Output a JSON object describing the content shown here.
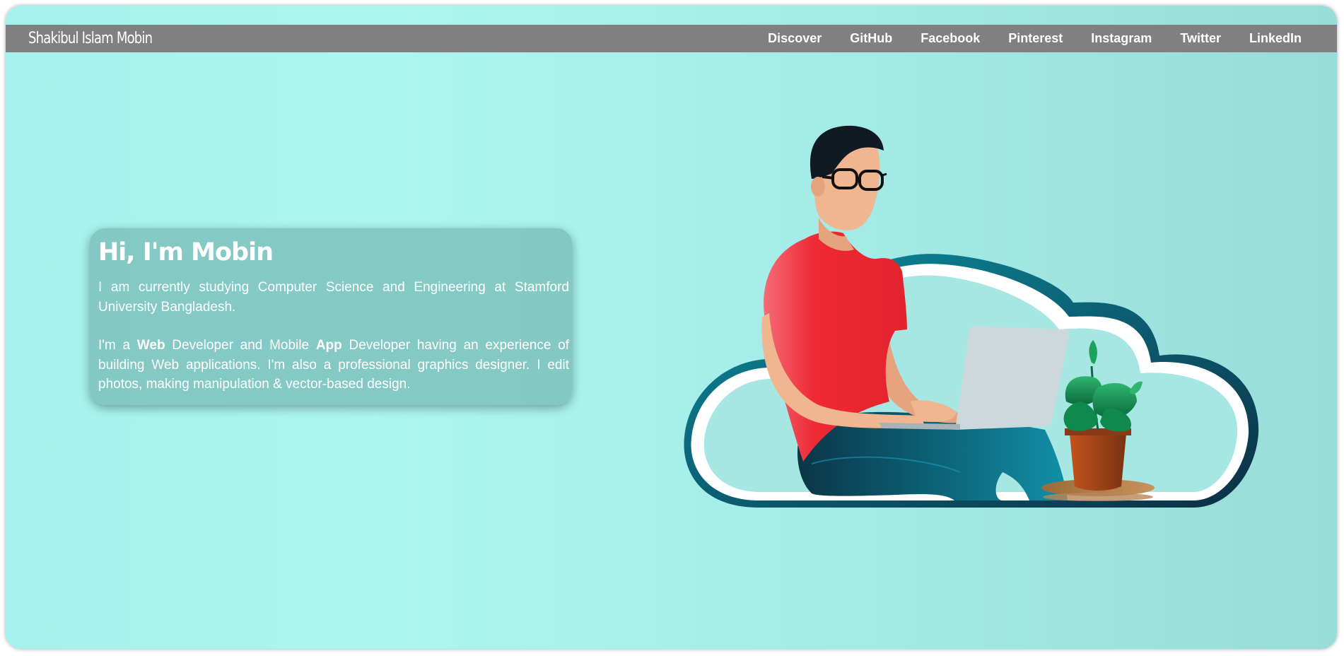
{
  "brand": "Shakibul Islam Mobin",
  "nav": {
    "items": [
      {
        "label": "Discover"
      },
      {
        "label": "GitHub"
      },
      {
        "label": "Facebook"
      },
      {
        "label": "Pinterest"
      },
      {
        "label": "Instagram"
      },
      {
        "label": "Twitter"
      },
      {
        "label": "LinkedIn"
      }
    ]
  },
  "intro": {
    "heading": "Hi, I'm Mobin",
    "paragraph1": "I am currently studying Computer Science and Engineering at Stamford University Bangladesh.",
    "p2": {
      "prefix": "I'm a ",
      "strong1": "Web",
      "middle": " Developer and Mobile ",
      "strong2": "App",
      "suffix": " Developer having an experience of building Web applications. I'm also a professional graphics designer. I edit photos, making manipulation & vector-based design."
    }
  },
  "illustration": {
    "icons": [
      "cloud-icon",
      "person-with-laptop-icon",
      "potted-plant-icon"
    ]
  },
  "colors": {
    "navbar": "#808080",
    "background_start": "#a4f1ed",
    "background_end": "#99dcd9",
    "card": "#7abcb9",
    "shirt": "#ee2a34",
    "pants": "#0e6a80"
  }
}
